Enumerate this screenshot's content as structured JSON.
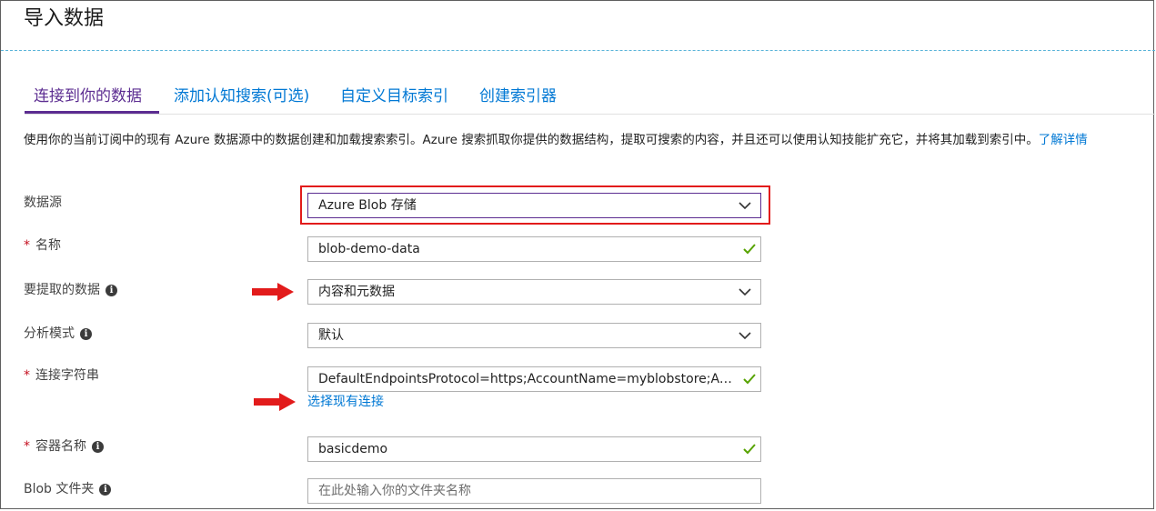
{
  "page": {
    "title": "导入数据"
  },
  "tabs": [
    {
      "label": "连接到你的数据",
      "active": true
    },
    {
      "label": "添加认知搜索(可选)",
      "active": false
    },
    {
      "label": "自定义目标索引",
      "active": false
    },
    {
      "label": "创建索引器",
      "active": false
    }
  ],
  "description": {
    "text": "使用你的当前订阅中的现有 Azure 数据源中的数据创建和加载搜索索引。Azure 搜索抓取你提供的数据结构，提取可搜索的内容，并且还可以使用认知技能扩充它，并将其加载到索引中。",
    "link": "了解详情"
  },
  "form": {
    "data_source": {
      "label": "数据源",
      "value": "Azure Blob 存储"
    },
    "name": {
      "required_mark": "*",
      "label": "名称",
      "value": "blob-demo-data"
    },
    "data_to_extract": {
      "label": "要提取的数据",
      "value": "内容和元数据"
    },
    "parsing_mode": {
      "label": "分析模式",
      "value": "默认"
    },
    "connection_string": {
      "required_mark": "*",
      "label": "连接字符串",
      "value": "DefaultEndpointsProtocol=https;AccountName=myblobstore;AccountKey=",
      "link": "选择现有连接"
    },
    "container_name": {
      "required_mark": "*",
      "label": "容器名称",
      "value": "basicdemo"
    },
    "blob_folder": {
      "label": "Blob 文件夹",
      "placeholder": "在此处输入你的文件夹名称",
      "value": ""
    }
  },
  "icons": {
    "info": "info-icon",
    "valid": "check-icon",
    "dropdown": "chevron-down-icon",
    "callout": "red-arrow-icon"
  },
  "colors": {
    "accent": "#5c2d91",
    "link": "#0078d4",
    "valid": "#57a300",
    "highlight": "#e21b1b"
  }
}
